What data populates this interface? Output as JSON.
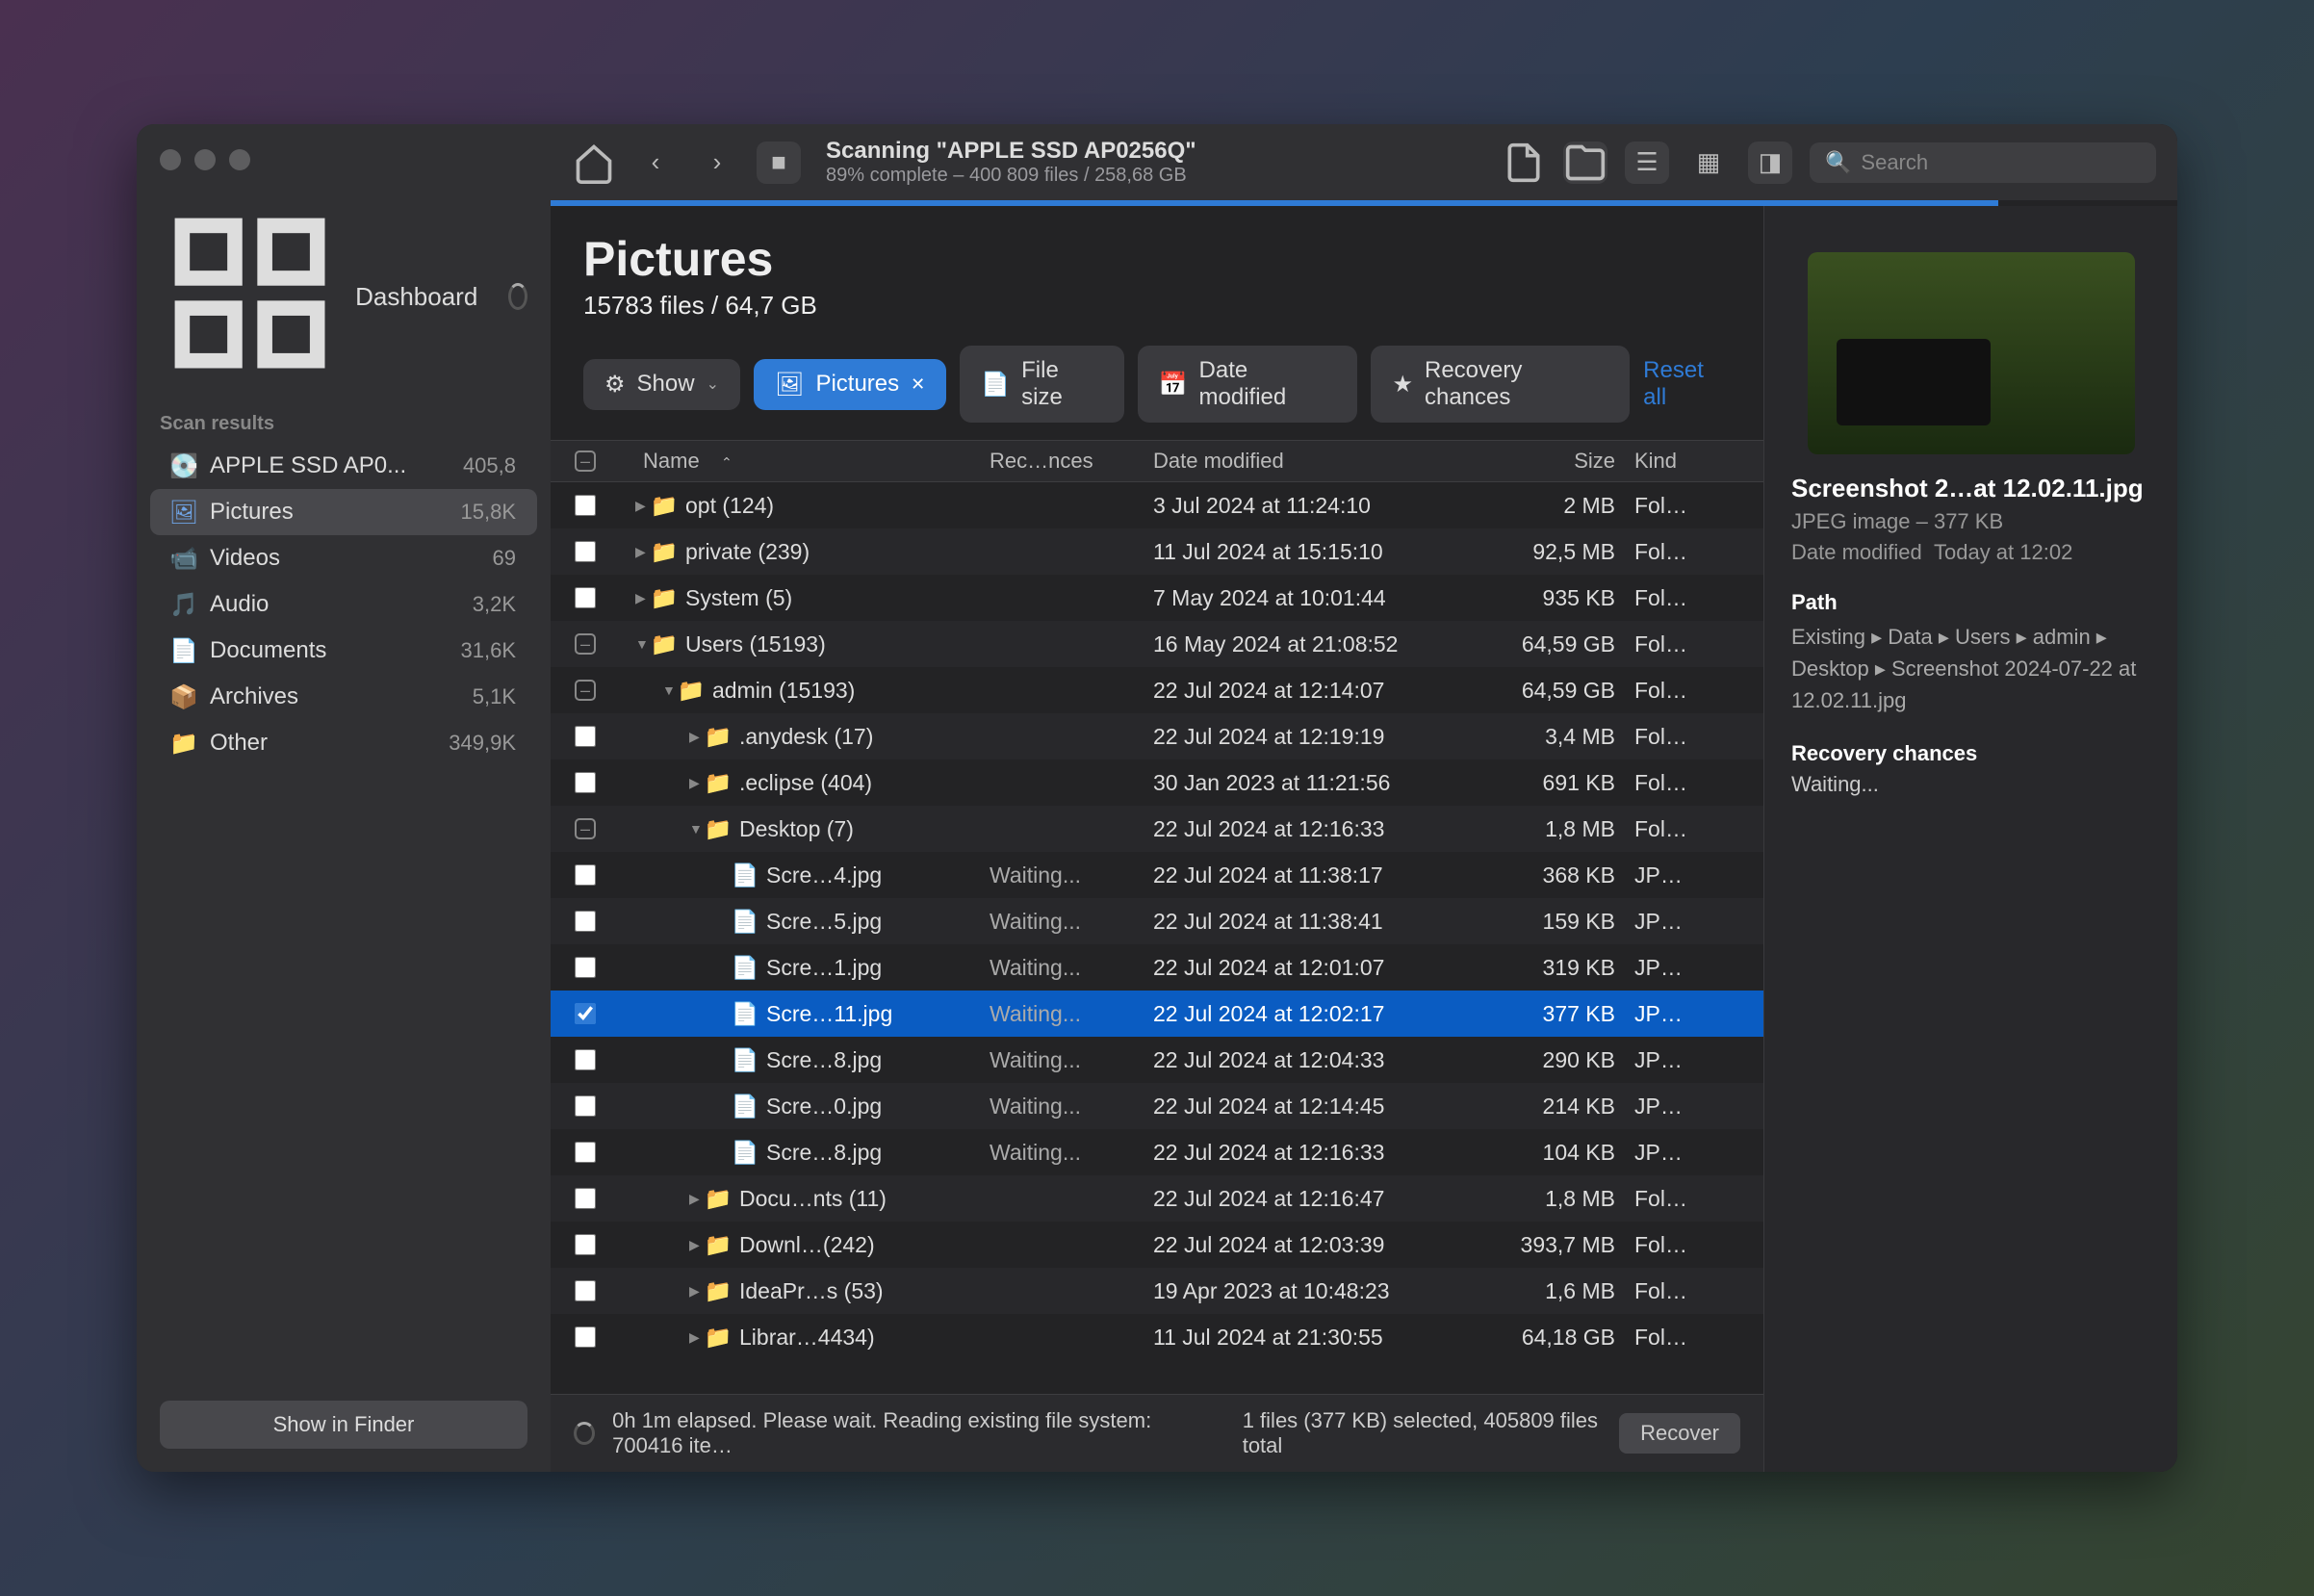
{
  "sidebar": {
    "dashboard": "Dashboard",
    "section": "Scan results",
    "items": [
      {
        "label": "APPLE SSD AP0...",
        "count": "405,8"
      },
      {
        "label": "Pictures",
        "count": "15,8K"
      },
      {
        "label": "Videos",
        "count": "69"
      },
      {
        "label": "Audio",
        "count": "3,2K"
      },
      {
        "label": "Documents",
        "count": "31,6K"
      },
      {
        "label": "Archives",
        "count": "5,1K"
      },
      {
        "label": "Other",
        "count": "349,9K"
      }
    ],
    "finder_btn": "Show in Finder"
  },
  "scan": {
    "title": "Scanning \"APPLE SSD AP0256Q\"",
    "sub": "89% complete – 400 809 files / 258,68 GB",
    "search_ph": "Search"
  },
  "heading": {
    "title": "Pictures",
    "sub": "15783 files / 64,7 GB"
  },
  "filters": {
    "show": "Show",
    "pictures": "Pictures",
    "filesize": "File size",
    "date": "Date modified",
    "recovery": "Recovery chances",
    "reset": "Reset all"
  },
  "columns": {
    "name": "Name",
    "rec": "Rec…nces",
    "date": "Date modified",
    "size": "Size",
    "kind": "Kind"
  },
  "rows": [
    {
      "chk": "",
      "indent": 1,
      "disc": "▶",
      "type": "folder",
      "name": "opt (124)",
      "rec": "",
      "date": "3 Jul 2024 at 11:24:10",
      "size": "2 MB",
      "kind": "Fol…"
    },
    {
      "chk": "",
      "indent": 1,
      "disc": "▶",
      "type": "folder",
      "name": "private (239)",
      "rec": "",
      "date": "11 Jul 2024 at 15:15:10",
      "size": "92,5 MB",
      "kind": "Fol…"
    },
    {
      "chk": "",
      "indent": 1,
      "disc": "▶",
      "type": "folder",
      "name": "System (5)",
      "rec": "",
      "date": "7 May 2024 at 10:01:44",
      "size": "935 KB",
      "kind": "Fol…"
    },
    {
      "chk": "dash",
      "indent": 1,
      "disc": "▼",
      "type": "folder",
      "name": "Users (15193)",
      "rec": "",
      "date": "16 May 2024 at 21:08:52",
      "size": "64,59 GB",
      "kind": "Fol…"
    },
    {
      "chk": "dash",
      "indent": 2,
      "disc": "▼",
      "type": "folder",
      "name": "admin (15193)",
      "rec": "",
      "date": "22 Jul 2024 at 12:14:07",
      "size": "64,59 GB",
      "kind": "Fol…"
    },
    {
      "chk": "",
      "indent": 3,
      "disc": "▶",
      "type": "folder",
      "name": ".anydesk (17)",
      "rec": "",
      "date": "22 Jul 2024 at 12:19:19",
      "size": "3,4 MB",
      "kind": "Fol…"
    },
    {
      "chk": "",
      "indent": 3,
      "disc": "▶",
      "type": "folder",
      "name": ".eclipse (404)",
      "rec": "",
      "date": "30 Jan 2023 at 11:21:56",
      "size": "691 KB",
      "kind": "Fol…"
    },
    {
      "chk": "dash",
      "indent": 3,
      "disc": "▼",
      "type": "folder",
      "name": "Desktop (7)",
      "rec": "",
      "date": "22 Jul 2024 at 12:16:33",
      "size": "1,8 MB",
      "kind": "Fol…"
    },
    {
      "chk": "",
      "indent": 4,
      "disc": "",
      "type": "file",
      "name": "Scre…4.jpg",
      "rec": "Waiting...",
      "date": "22 Jul 2024 at 11:38:17",
      "size": "368 KB",
      "kind": "JP…"
    },
    {
      "chk": "",
      "indent": 4,
      "disc": "",
      "type": "file",
      "name": "Scre…5.jpg",
      "rec": "Waiting...",
      "date": "22 Jul 2024 at 11:38:41",
      "size": "159 KB",
      "kind": "JP…"
    },
    {
      "chk": "",
      "indent": 4,
      "disc": "",
      "type": "file",
      "name": "Scre…1.jpg",
      "rec": "Waiting...",
      "date": "22 Jul 2024 at 12:01:07",
      "size": "319 KB",
      "kind": "JP…"
    },
    {
      "chk": "on",
      "indent": 4,
      "disc": "",
      "type": "file",
      "name": "Scre…11.jpg",
      "rec": "Waiting...",
      "date": "22 Jul 2024 at 12:02:17",
      "size": "377 KB",
      "kind": "JP…",
      "selected": true
    },
    {
      "chk": "",
      "indent": 4,
      "disc": "",
      "type": "file",
      "name": "Scre…8.jpg",
      "rec": "Waiting...",
      "date": "22 Jul 2024 at 12:04:33",
      "size": "290 KB",
      "kind": "JP…"
    },
    {
      "chk": "",
      "indent": 4,
      "disc": "",
      "type": "file",
      "name": "Scre…0.jpg",
      "rec": "Waiting...",
      "date": "22 Jul 2024 at 12:14:45",
      "size": "214 KB",
      "kind": "JP…"
    },
    {
      "chk": "",
      "indent": 4,
      "disc": "",
      "type": "file",
      "name": "Scre…8.jpg",
      "rec": "Waiting...",
      "date": "22 Jul 2024 at 12:16:33",
      "size": "104 KB",
      "kind": "JP…"
    },
    {
      "chk": "",
      "indent": 3,
      "disc": "▶",
      "type": "folder",
      "name": "Docu…nts (11)",
      "rec": "",
      "date": "22 Jul 2024 at 12:16:47",
      "size": "1,8 MB",
      "kind": "Fol…"
    },
    {
      "chk": "",
      "indent": 3,
      "disc": "▶",
      "type": "folder-dl",
      "name": "Downl…(242)",
      "rec": "",
      "date": "22 Jul 2024 at 12:03:39",
      "size": "393,7 MB",
      "kind": "Fol…"
    },
    {
      "chk": "",
      "indent": 3,
      "disc": "▶",
      "type": "folder",
      "name": "IdeaPr…s (53)",
      "rec": "",
      "date": "19 Apr 2023 at 10:48:23",
      "size": "1,6 MB",
      "kind": "Fol…"
    },
    {
      "chk": "",
      "indent": 3,
      "disc": "▶",
      "type": "folder",
      "name": "Librar…4434)",
      "rec": "",
      "date": "11 Jul 2024 at 21:30:55",
      "size": "64,18 GB",
      "kind": "Fol…"
    }
  ],
  "details": {
    "title": "Screenshot 2…at 12.02.11.jpg",
    "meta1": "JPEG image – 377 KB",
    "meta2_l": "Date modified",
    "meta2_v": "Today at 12:02",
    "path_t": "Path",
    "path": "Existing ▸ Data ▸ Users ▸ admin ▸ Desktop ▸ Screenshot 2024-07-22 at 12.02.11.jpg",
    "rec_t": "Recovery chances",
    "rec_v": "Waiting..."
  },
  "status": {
    "left": "0h 1m elapsed. Please wait. Reading existing file system: 700416 ite…",
    "mid": "1 files (377 KB) selected, 405809 files total",
    "recover": "Recover"
  }
}
